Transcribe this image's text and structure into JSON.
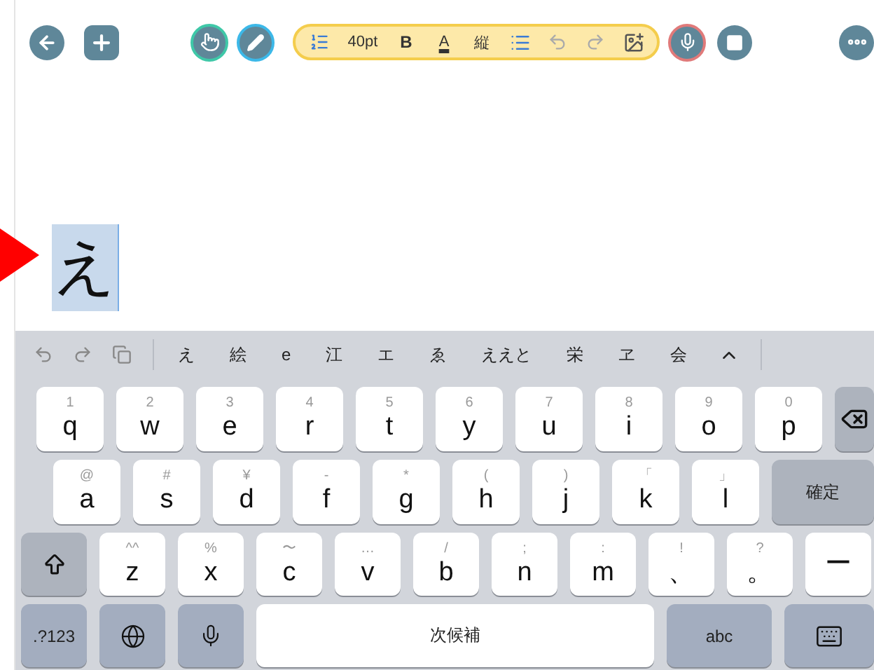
{
  "toolbar": {
    "left": [
      {
        "kind": "back"
      },
      {
        "kind": "add"
      }
    ],
    "tools": [
      {
        "kind": "hand",
        "color": "#3fc8a8"
      },
      {
        "kind": "pen",
        "color": "#3cb8e8"
      }
    ],
    "format": [
      {
        "kind": "spacing"
      },
      {
        "kind": "size",
        "label": "40pt"
      },
      {
        "kind": "bold",
        "label": "B"
      },
      {
        "kind": "color",
        "label": "A"
      },
      {
        "kind": "vertical",
        "label": "縦"
      },
      {
        "kind": "list"
      },
      {
        "kind": "undo"
      },
      {
        "kind": "redo"
      },
      {
        "kind": "insert"
      }
    ],
    "record": [
      {
        "kind": "mic",
        "color": "#e07a7a"
      },
      {
        "kind": "stop"
      }
    ],
    "right": [
      {
        "kind": "more"
      }
    ]
  },
  "editor": {
    "text": "え",
    "selected": true
  },
  "keyboard": {
    "candidates": [
      "え",
      "絵",
      "e",
      "江",
      "エ",
      "ゑ",
      "ええと",
      "栄",
      "ヱ",
      "会"
    ],
    "key_rows": [
      {
        "keys": [
          {
            "kind": "char",
            "main": "q",
            "hint": "1"
          },
          {
            "kind": "char",
            "main": "w",
            "hint": "2"
          },
          {
            "kind": "char",
            "main": "e",
            "hint": "3"
          },
          {
            "kind": "char",
            "main": "r",
            "hint": "4"
          },
          {
            "kind": "char",
            "main": "t",
            "hint": "5"
          },
          {
            "kind": "char",
            "main": "y",
            "hint": "6"
          },
          {
            "kind": "char",
            "main": "u",
            "hint": "7"
          },
          {
            "kind": "char",
            "main": "i",
            "hint": "8"
          },
          {
            "kind": "char",
            "main": "o",
            "hint": "9"
          },
          {
            "kind": "char",
            "main": "p",
            "hint": "0"
          },
          {
            "kind": "backspace"
          }
        ]
      },
      {
        "keys": [
          {
            "kind": "char",
            "main": "a",
            "hint": "@"
          },
          {
            "kind": "char",
            "main": "s",
            "hint": "#"
          },
          {
            "kind": "char",
            "main": "d",
            "hint": "¥"
          },
          {
            "kind": "char",
            "main": "f",
            "hint": "-"
          },
          {
            "kind": "char",
            "main": "g",
            "hint": "*"
          },
          {
            "kind": "char",
            "main": "h",
            "hint": "("
          },
          {
            "kind": "char",
            "main": "j",
            "hint": ")"
          },
          {
            "kind": "char",
            "main": "k",
            "hint": "「"
          },
          {
            "kind": "char",
            "main": "l",
            "hint": "」"
          },
          {
            "kind": "action",
            "main": "確定"
          }
        ]
      },
      {
        "keys": [
          {
            "kind": "shift"
          },
          {
            "kind": "char",
            "main": "z",
            "hint": "^^"
          },
          {
            "kind": "char",
            "main": "x",
            "hint": "%"
          },
          {
            "kind": "char",
            "main": "c",
            "hint": "〜"
          },
          {
            "kind": "char",
            "main": "v",
            "hint": "…"
          },
          {
            "kind": "char",
            "main": "b",
            "hint": "/"
          },
          {
            "kind": "char",
            "main": "n",
            "hint": ";"
          },
          {
            "kind": "char",
            "main": "m",
            "hint": ":"
          },
          {
            "kind": "char",
            "main": "、",
            "hint": "!"
          },
          {
            "kind": "char",
            "main": "。",
            "hint": "?"
          },
          {
            "kind": "char",
            "main": "ー"
          }
        ]
      },
      {
        "keys": [
          {
            "kind": "mode",
            "main": ".?123"
          },
          {
            "kind": "globe"
          },
          {
            "kind": "mic"
          },
          {
            "kind": "space",
            "main": "次候補"
          },
          {
            "kind": "letters",
            "main": "abc"
          },
          {
            "kind": "dismiss"
          }
        ]
      }
    ]
  }
}
